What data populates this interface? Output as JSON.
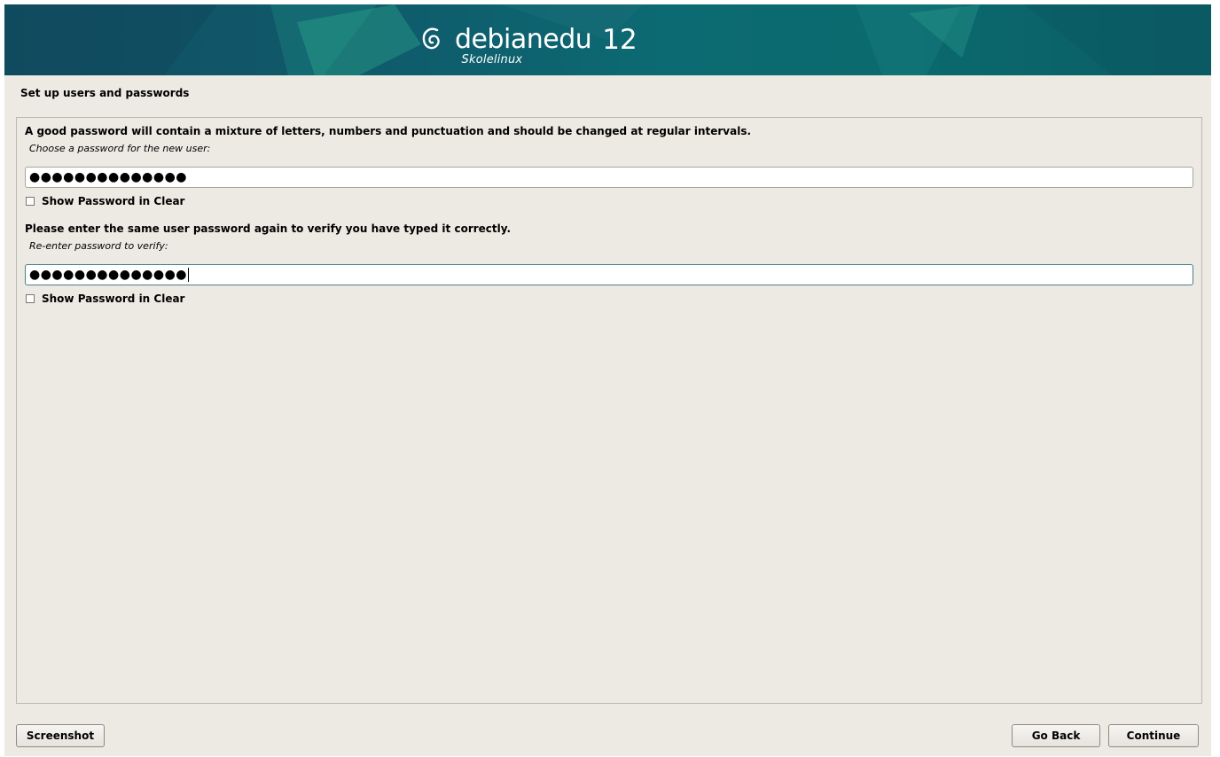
{
  "banner": {
    "brand": "debianedu",
    "version": "12",
    "subtitle": "Skolelinux"
  },
  "page": {
    "title": "Set up users and passwords"
  },
  "form": {
    "intro": "A good password will contain a mixture of letters, numbers and punctuation and should be changed at regular intervals.",
    "password_prompt": "Choose a password for the new user:",
    "password_value": "●●●●●●●●●●●●●●",
    "show_clear_label_1": "Show Password in Clear",
    "verify_intro": "Please enter the same user password again to verify you have typed it correctly.",
    "verify_prompt": "Re-enter password to verify:",
    "verify_value": "●●●●●●●●●●●●●●",
    "show_clear_label_2": "Show Password in Clear"
  },
  "buttons": {
    "screenshot": "Screenshot",
    "go_back": "Go Back",
    "continue": "Continue"
  },
  "colors": {
    "banner": "#0f5a6b",
    "background": "#edeae3",
    "focus_border": "#4a7f8a"
  }
}
